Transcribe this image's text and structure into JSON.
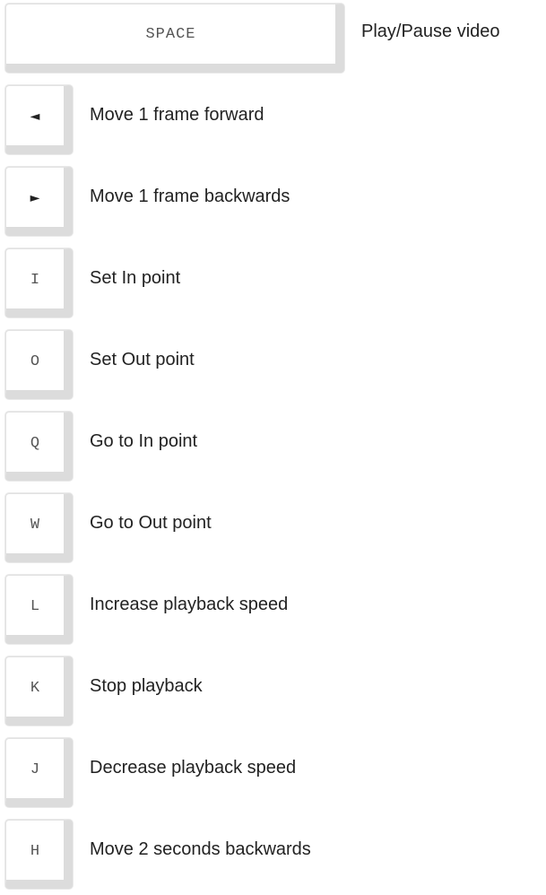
{
  "shortcuts": [
    {
      "key": "SPACE",
      "description": "Play/Pause video"
    },
    {
      "key": "◄",
      "description": "Move 1 frame forward"
    },
    {
      "key": "►",
      "description": "Move 1 frame backwards"
    },
    {
      "key": "I",
      "description": "Set In point"
    },
    {
      "key": "O",
      "description": "Set Out point"
    },
    {
      "key": "Q",
      "description": "Go to In point"
    },
    {
      "key": "W",
      "description": "Go to Out point"
    },
    {
      "key": "L",
      "description": "Increase playback speed"
    },
    {
      "key": "K",
      "description": "Stop playback"
    },
    {
      "key": "J",
      "description": "Decrease playback speed"
    },
    {
      "key": "H",
      "description": "Move 2 seconds backwards"
    }
  ]
}
